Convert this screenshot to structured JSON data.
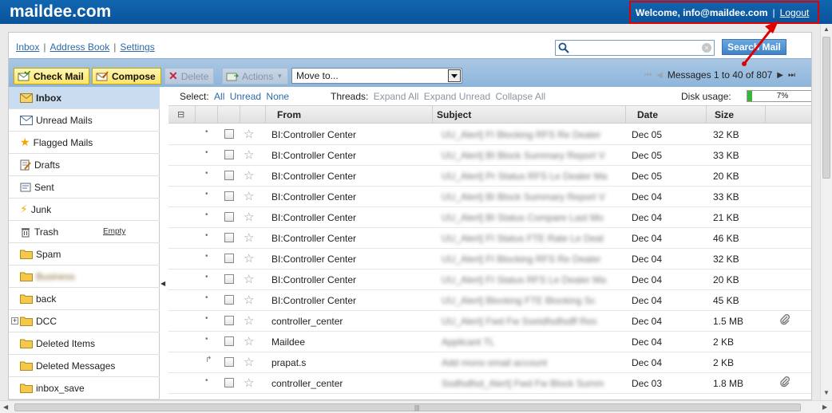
{
  "header": {
    "brand": "maildee.com",
    "welcome": "Welcome, info@maildee.com",
    "separator": "|",
    "logout": "Logout"
  },
  "nav": {
    "inbox": "Inbox",
    "address_book": "Address Book",
    "settings": "Settings",
    "sep": "|"
  },
  "search": {
    "placeholder": "",
    "button": "Search Mail"
  },
  "toolbar": {
    "check_mail": "Check Mail",
    "compose": "Compose",
    "delete": "Delete",
    "actions": "Actions",
    "move_to": "Move to...",
    "messages": "Messages 1 to 40 of 807"
  },
  "sidebar": {
    "empty_label": "Empty",
    "folders": [
      {
        "label": "Inbox",
        "icon": "inbox-icon"
      },
      {
        "label": "Unread Mails",
        "icon": "envelope-icon"
      },
      {
        "label": "Flagged Mails",
        "icon": "star-icon"
      },
      {
        "label": "Drafts",
        "icon": "drafts-icon"
      },
      {
        "label": "Sent",
        "icon": "sent-icon"
      },
      {
        "label": "Junk",
        "icon": "junk-icon"
      },
      {
        "label": "Trash",
        "icon": "trash-icon"
      },
      {
        "label": "Spam",
        "icon": "folder-icon"
      },
      {
        "label": "Business",
        "icon": "folder-icon"
      },
      {
        "label": "back",
        "icon": "folder-icon"
      },
      {
        "label": "DCC",
        "icon": "folder-icon"
      },
      {
        "label": "Deleted Items",
        "icon": "folder-icon"
      },
      {
        "label": "Deleted Messages",
        "icon": "folder-icon"
      },
      {
        "label": "inbox_save",
        "icon": "folder-icon"
      }
    ]
  },
  "filters": {
    "select_label": "Select:",
    "all": "All",
    "unread": "Unread",
    "none": "None",
    "threads_label": "Threads:",
    "expand_all": "Expand All",
    "expand_unread": "Expand Unread",
    "collapse_all": "Collapse All",
    "disk_label": "Disk usage:",
    "disk_percent": "7%",
    "disk_fraction": 0.07
  },
  "table": {
    "columns": {
      "from": "From",
      "subject": "Subject",
      "date": "Date",
      "size": "Size"
    },
    "rows": [
      {
        "marker": "•",
        "from": "BI:Controller Center",
        "subject": "UU_Alert] FI Blocking RFS Re Dealer",
        "date": "Dec 05",
        "size": "32 KB",
        "attachment": false
      },
      {
        "marker": "•",
        "from": "BI:Controller Center",
        "subject": "UU_Alert] BI Block Summary Report V",
        "date": "Dec 05",
        "size": "33 KB",
        "attachment": false
      },
      {
        "marker": "•",
        "from": "BI:Controller Center",
        "subject": "UU_Alert] Pr Status RFS Le Dealer Ma",
        "date": "Dec 05",
        "size": "20 KB",
        "attachment": false
      },
      {
        "marker": "•",
        "from": "BI:Controller Center",
        "subject": "UU_Alert] BI Block Summary Report V",
        "date": "Dec 04",
        "size": "33 KB",
        "attachment": false
      },
      {
        "marker": "•",
        "from": "BI:Controller Center",
        "subject": "UU_Alert] BI Status Compare Last Mo",
        "date": "Dec 04",
        "size": "21 KB",
        "attachment": false
      },
      {
        "marker": "•",
        "from": "BI:Controller Center",
        "subject": "UU_Alert] FI Status FTE Rate Le Deal",
        "date": "Dec 04",
        "size": "46 KB",
        "attachment": false
      },
      {
        "marker": "•",
        "from": "BI:Controller Center",
        "subject": "UU_Alert] FI Blocking RFS Re Dealer",
        "date": "Dec 04",
        "size": "32 KB",
        "attachment": false
      },
      {
        "marker": "•",
        "from": "BI:Controller Center",
        "subject": "UU_Alert] FI Status RFS Le Dealer Ma",
        "date": "Dec 04",
        "size": "20 KB",
        "attachment": false
      },
      {
        "marker": "•",
        "from": "BI:Controller Center",
        "subject": "UU_Alert] Blocking FTE Blocking Sc",
        "date": "Dec 04",
        "size": "45 KB",
        "attachment": false
      },
      {
        "marker": "•",
        "from": "controller_center",
        "subject": "UU_Alert] Fwd Fw Ssetdfsdfsdff Res",
        "date": "Dec 04",
        "size": "1.5 MB",
        "attachment": true
      },
      {
        "marker": "•",
        "from": "Maildee",
        "subject": "Applicant TL",
        "date": "Dec 04",
        "size": "2 KB",
        "attachment": false
      },
      {
        "marker": "↱",
        "from": "prapat.s",
        "subject": "Add mono email account",
        "date": "Dec 04",
        "size": "2 KB",
        "attachment": false
      },
      {
        "marker": "•",
        "from": "controller_center",
        "subject": "Ssdfsdfsd_Alert] Fwd Fw Block Summ",
        "date": "Dec 03",
        "size": "1.8 MB",
        "attachment": true
      }
    ]
  },
  "colors": {
    "header_bg": "#0a539a",
    "toolbar_bg": "#8db5da",
    "button_yellow": "#ffe46a",
    "annotation_red": "#e00000",
    "disk_green": "#3bb43b"
  }
}
